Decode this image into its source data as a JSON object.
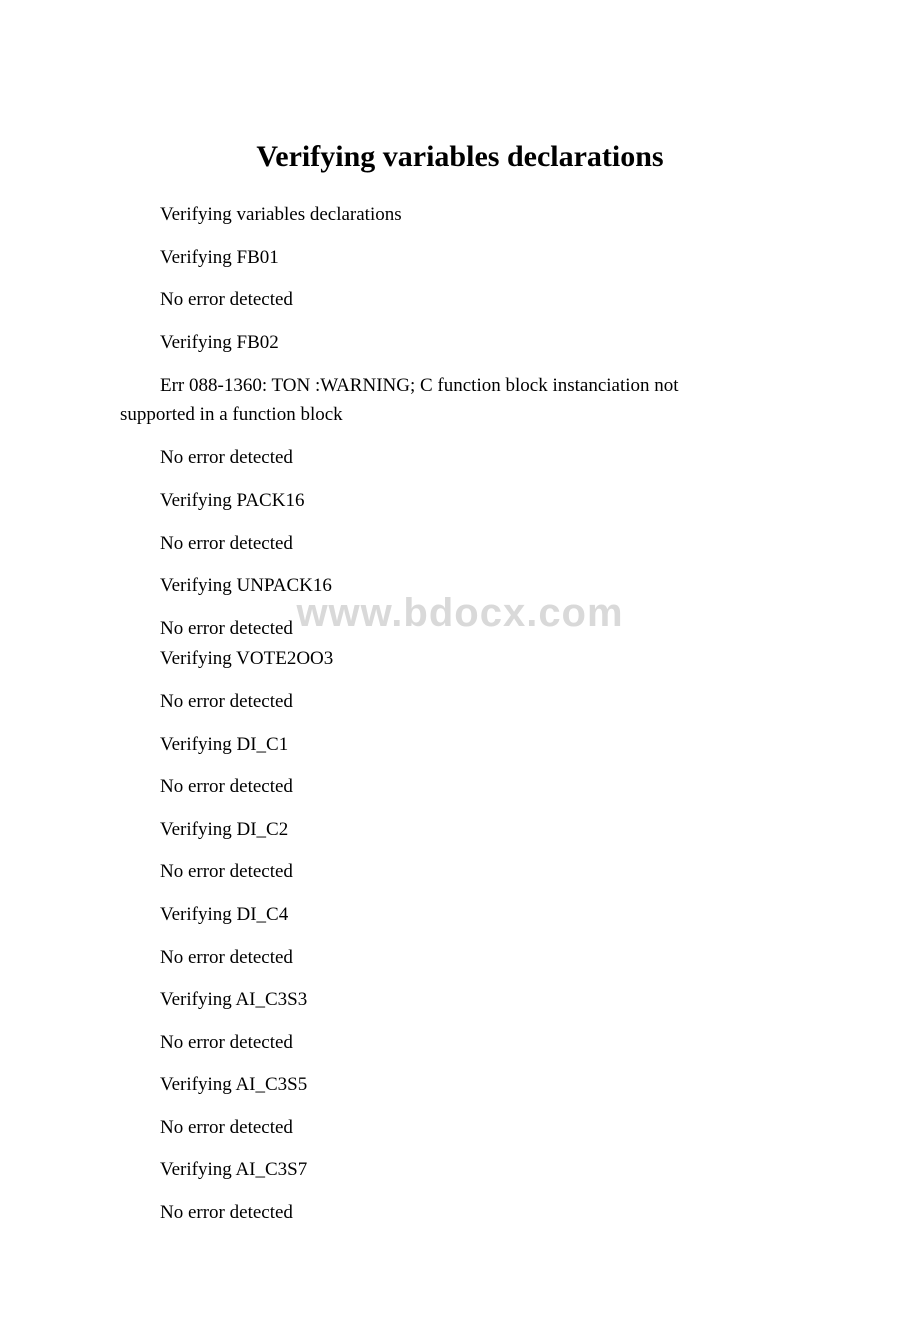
{
  "title": "Verifying variables declarations",
  "watermark": "www.bdocx.com",
  "lines": {
    "l0": "Verifying variables declarations",
    "l1": "Verifying FB01",
    "l2": "No error detected",
    "l3": "Verifying FB02",
    "l4a": "Err 088-1360: TON :WARNING; C function block instanciation not",
    "l4b": "supported in a function block",
    "l5": "No error detected",
    "l6": "Verifying PACK16",
    "l7": "No error detected",
    "l8": "Verifying UNPACK16",
    "l9": "No error detected",
    "l10": "Verifying VOTE2OO3",
    "l11": "No error detected",
    "l12": "Verifying DI_C1",
    "l13": "No error detected",
    "l14": "Verifying DI_C2",
    "l15": "No error detected",
    "l16": "Verifying DI_C4",
    "l17": "No error detected",
    "l18": "Verifying AI_C3S3",
    "l19": "No error detected",
    "l20": "Verifying AI_C3S5",
    "l21": "No error detected",
    "l22": "Verifying AI_C3S7",
    "l23": "No error detected"
  }
}
